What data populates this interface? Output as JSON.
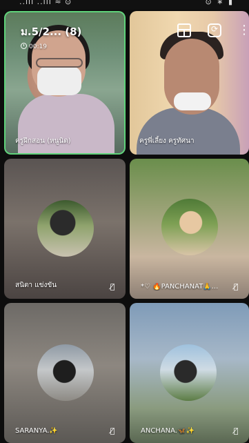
{
  "status_bar": {
    "left_text": "..ııl ..ııl ≈ ⊙",
    "right_text": "⊙ ∗ ▮"
  },
  "call": {
    "title": "ม.5/2... (8)",
    "timer": "00:19"
  },
  "participants": [
    {
      "name": "ครูฝึกสอน (หนูนิด)",
      "muted": false,
      "active": true
    },
    {
      "name": "ครูพี่เลี้ยง ครูทัศนา",
      "muted": false,
      "active": false
    },
    {
      "name": "สนิตา แข่งขัน",
      "muted": true,
      "active": false
    },
    {
      "name": "*♡ 🔥PANCHANAT🙏...",
      "muted": true,
      "active": false
    },
    {
      "name": "SARANYA.✨",
      "muted": true,
      "active": false
    },
    {
      "name": "ANCHANA.🦋✨",
      "muted": true,
      "active": false
    }
  ],
  "icons": {
    "layout": "layout-icon",
    "camera_switch": "camera-switch-icon",
    "more": "more-vertical-icon",
    "mic_off": "mic-off-icon",
    "clock": "clock-icon"
  },
  "colors": {
    "active_speaker_border": "#5fd37a",
    "background": "#0d0d0d"
  }
}
